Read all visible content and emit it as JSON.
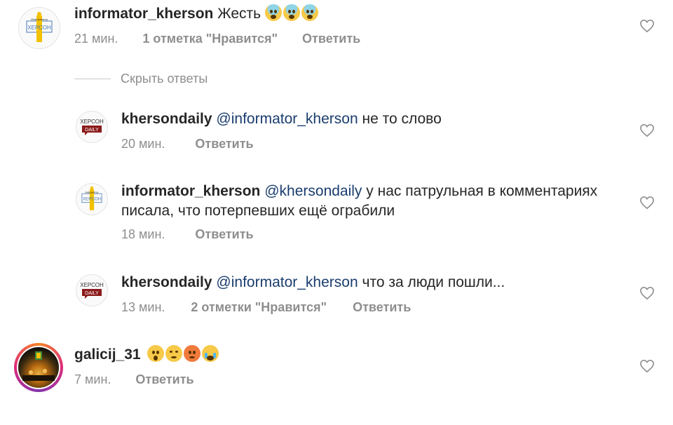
{
  "comments": [
    {
      "username": "informator_kherson",
      "text": "Жесть",
      "emojis": [
        "fearful-face",
        "fearful-face",
        "fearful-face"
      ],
      "time": "21 мин.",
      "likes": "1 отметка \"Нравится\"",
      "reply": "Ответить",
      "avatar_text": [
        "Информатор",
        "ХЕРСОН"
      ]
    }
  ],
  "hide_replies": "Скрыть ответы",
  "replies": [
    {
      "username": "khersondaily",
      "mention": "@informator_kherson",
      "text": "не то слово",
      "time": "20 мин.",
      "reply": "Ответить",
      "avatar_text": [
        "ХЕРСОН",
        "DAILY"
      ]
    },
    {
      "username": "informator_kherson",
      "mention": "@khersondaily",
      "text": "у нас патрульная в комментариях",
      "text2": "писала, что потерпевших ещё ограбили",
      "time": "18 мин.",
      "reply": "Ответить",
      "avatar_text": [
        "Информатор",
        "ХЕРСОН"
      ]
    },
    {
      "username": "khersondaily",
      "mention": "@informator_kherson",
      "text": "что за люди пошли...",
      "time": "13 мин.",
      "likes": "2 отметки \"Нравится\"",
      "reply": "Ответить",
      "avatar_text": [
        "ХЕРСОН",
        "DAILY"
      ]
    }
  ],
  "last_comment": {
    "username": "galicij_31",
    "emojis": [
      "astonished-face",
      "confounded-face",
      "frowning-face",
      "crying-face"
    ],
    "time": "7 мин.",
    "reply": "Ответить"
  },
  "colors": {
    "username": "#262626",
    "mention": "#1a3d6e",
    "meta": "#8e8e8e",
    "accent_yellow": "#f2c100",
    "daily_red": "#8b1a1a"
  },
  "icons": {
    "like": "heart-outline-icon"
  }
}
